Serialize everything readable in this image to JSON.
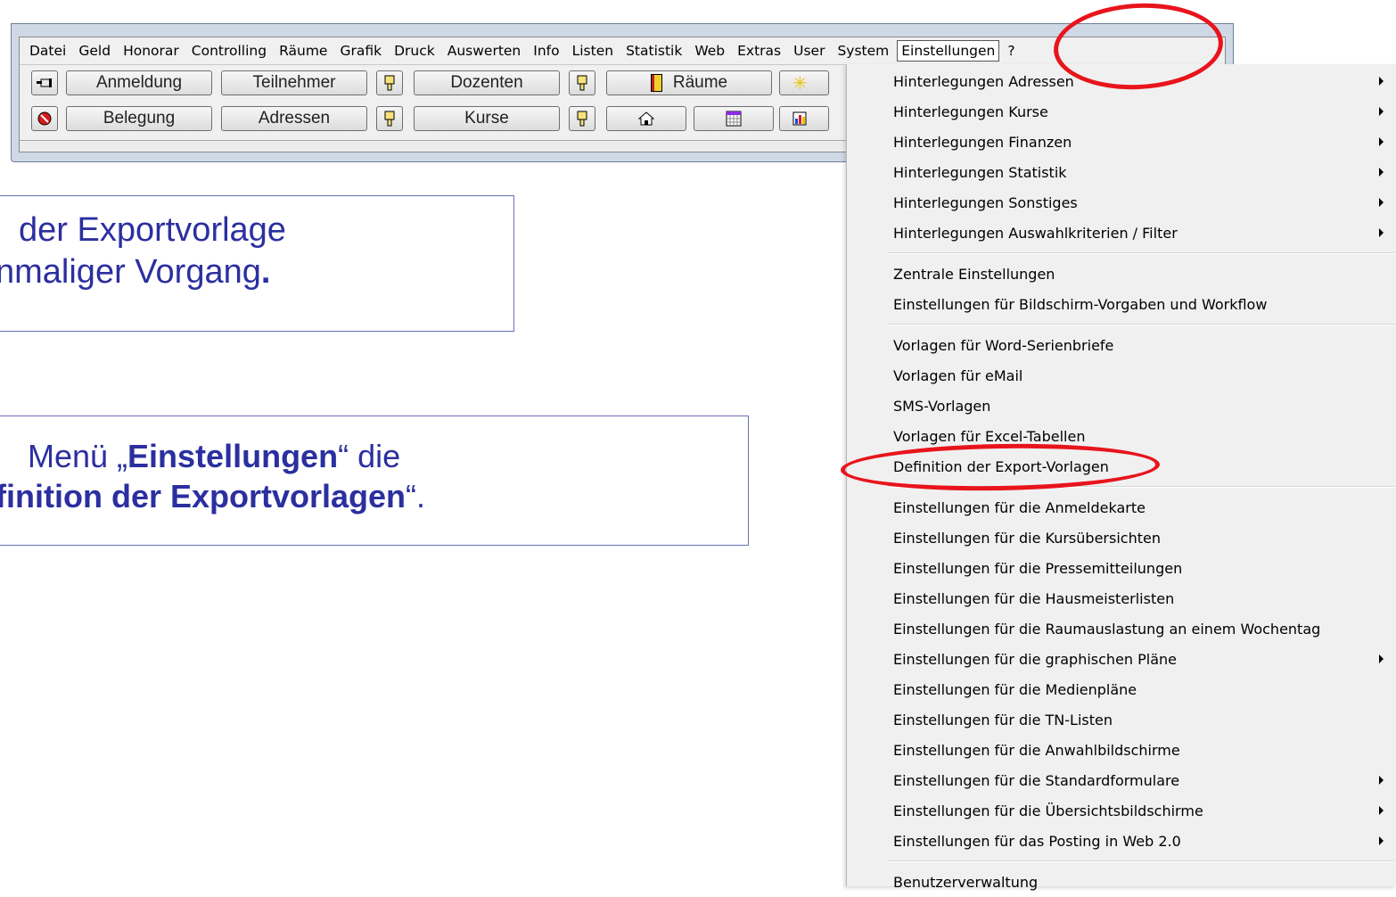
{
  "menubar": {
    "items": [
      "Datei",
      "Geld",
      "Honorar",
      "Controlling",
      "Räume",
      "Grafik",
      "Druck",
      "Auswerten",
      "Info",
      "Listen",
      "Statistik",
      "Web",
      "Extras",
      "User",
      "System",
      "Einstellungen",
      "?"
    ],
    "active": "Einstellungen"
  },
  "toolbar": {
    "row1": [
      "Anmeldung",
      "Teilnehmer",
      "Dozenten",
      "Räume"
    ],
    "row2": [
      "Belegung",
      "Adressen",
      "Kurse"
    ]
  },
  "textbox1": {
    "line1": "der Exportvorlage",
    "line2_a": "nmaliger Vorgang",
    "line2_b": "."
  },
  "textbox2": {
    "line1_a": "Menü „",
    "line1_b": "Einstellungen",
    "line1_c": "“  die",
    "line2_a": "finition der Exportvorlagen",
    "line2_b": "“."
  },
  "dropdown": {
    "groups": [
      [
        {
          "label": "Hinterlegungen Adressen",
          "submenu": true
        },
        {
          "label": "Hinterlegungen Kurse",
          "submenu": true
        },
        {
          "label": "Hinterlegungen Finanzen",
          "submenu": true
        },
        {
          "label": "Hinterlegungen Statistik",
          "submenu": true
        },
        {
          "label": "Hinterlegungen Sonstiges",
          "submenu": true
        },
        {
          "label": "Hinterlegungen Auswahlkriterien / Filter",
          "submenu": true
        }
      ],
      [
        {
          "label": "Zentrale Einstellungen",
          "submenu": false
        },
        {
          "label": "Einstellungen für Bildschirm-Vorgaben und Workflow",
          "submenu": false
        }
      ],
      [
        {
          "label": "Vorlagen für Word-Serienbriefe",
          "submenu": false
        },
        {
          "label": "Vorlagen für eMail",
          "submenu": false
        },
        {
          "label": "SMS-Vorlagen",
          "submenu": false
        },
        {
          "label": "Vorlagen für Excel-Tabellen",
          "submenu": false
        },
        {
          "label": "Definition der Export-Vorlagen",
          "submenu": false
        }
      ],
      [
        {
          "label": "Einstellungen für die Anmeldekarte",
          "submenu": false
        },
        {
          "label": "Einstellungen für die Kursübersichten",
          "submenu": false
        },
        {
          "label": "Einstellungen für die Pressemitteilungen",
          "submenu": false
        },
        {
          "label": "Einstellungen für die Hausmeisterlisten",
          "submenu": false
        },
        {
          "label": "Einstellungen für die Raumauslastung an einem Wochentag",
          "submenu": false
        },
        {
          "label": "Einstellungen für die graphischen Pläne",
          "submenu": true
        },
        {
          "label": "Einstellungen für die Medienpläne",
          "submenu": false
        },
        {
          "label": "Einstellungen für die TN-Listen",
          "submenu": false
        },
        {
          "label": "Einstellungen für die Anwahlbildschirme",
          "submenu": false
        },
        {
          "label": "Einstellungen für die Standardformulare",
          "submenu": true
        },
        {
          "label": "Einstellungen für die Übersichtsbildschirme",
          "submenu": true
        },
        {
          "label": "Einstellungen für das Posting in Web 2.0",
          "submenu": true
        }
      ],
      [
        {
          "label": "Benutzerverwaltung",
          "submenu": false
        }
      ]
    ]
  },
  "colors": {
    "annotation": "#e8141c",
    "slide_text": "#2b2f9f",
    "box_border": "#6a6fb8"
  }
}
